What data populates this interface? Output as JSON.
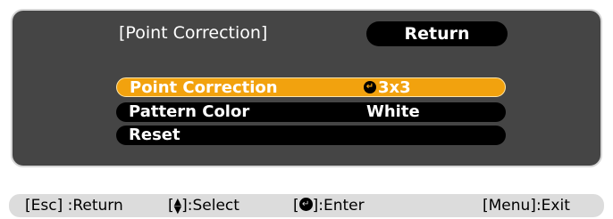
{
  "menu": {
    "title": "[Point Correction]",
    "return_label": "Return",
    "items": [
      {
        "label": "Point Correction",
        "value": "3x3",
        "selected": true
      },
      {
        "label": "Pattern Color",
        "value": "White",
        "selected": false
      },
      {
        "label": "Reset",
        "value": "",
        "selected": false
      }
    ]
  },
  "help": {
    "esc_key": "[Esc]",
    "esc_action": ":Return",
    "select_prefix": "[",
    "select_suffix": "]:Select",
    "enter_prefix": "[",
    "enter_suffix": "]:Enter",
    "menu_exit": "[Menu]:Exit"
  },
  "colors": {
    "panel_background": "#454545",
    "selected_row": "#f2a20e",
    "row_background": "#000000",
    "help_bar": "#dcdcdc"
  },
  "icons": {
    "enter": "enter-icon",
    "updown": "up-down-arrow-icon"
  }
}
